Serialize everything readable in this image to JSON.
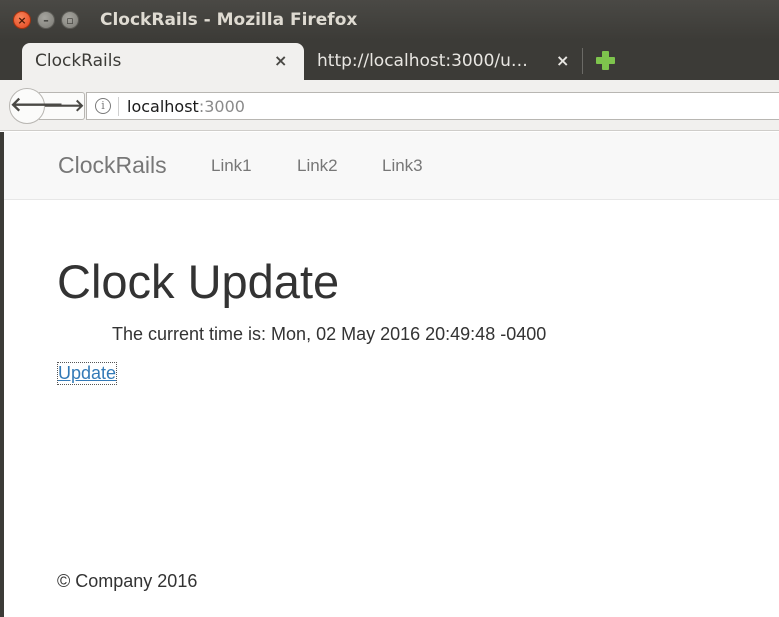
{
  "window": {
    "title": "ClockRails - Mozilla Firefox",
    "close_glyph": "×",
    "minimize_glyph": "–",
    "maximize_glyph": "▫"
  },
  "tabs": [
    {
      "label": "ClockRails",
      "close_glyph": "×",
      "active": true
    },
    {
      "label": "http://localhost:3000/u…",
      "close_glyph": "×",
      "active": false
    }
  ],
  "toolbar": {
    "back_glyph": "🡐",
    "forward_glyph": "🡒",
    "info_glyph": "i",
    "url_host": "localhost",
    "url_port": ":3000"
  },
  "site": {
    "brand": "ClockRails",
    "links": [
      "Link1",
      "Link2",
      "Link3"
    ]
  },
  "main": {
    "heading": "Clock Update",
    "time_text": "The current time is: Mon, 02 May 2016 20:49:48 -0400",
    "update_link": "Update"
  },
  "footer": {
    "text": "© Company 2016"
  },
  "colors": {
    "titlebar": "#3c3b37",
    "link": "#337ab7",
    "new_tab_plus": "#7ec44d",
    "close_button": "#e2431c"
  }
}
